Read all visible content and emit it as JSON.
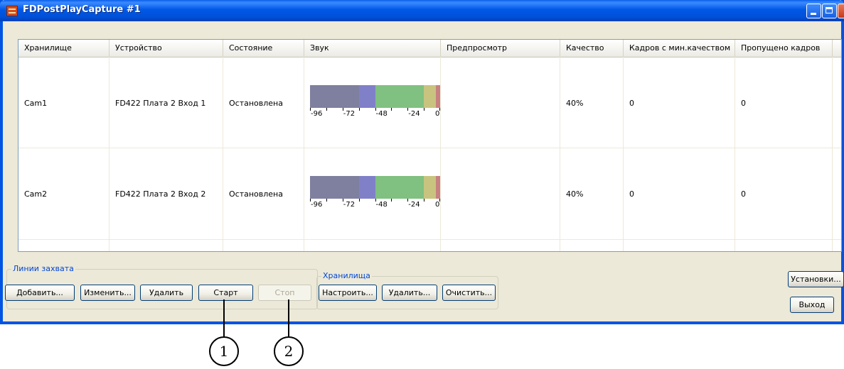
{
  "window": {
    "title": "FDPostPlayCapture #1"
  },
  "table": {
    "columns": [
      "Хранилище",
      "Устройство",
      "Состояние",
      "Звук",
      "Предпросмотр",
      "Качество",
      "Кадров с мин.качеством",
      "Пропущено кадров"
    ],
    "rows": [
      {
        "storage": "Cam1",
        "device": "FD422 Плата 2 Вход 1",
        "state": "Остановлена",
        "preview": "",
        "quality": "40%",
        "min_quality_frames": "0",
        "dropped_frames": "0"
      },
      {
        "storage": "Cam2",
        "device": "FD422 Плата 2 Вход 2",
        "state": "Остановлена",
        "preview": "",
        "quality": "40%",
        "min_quality_frames": "0",
        "dropped_frames": "0"
      }
    ]
  },
  "audio_meter": {
    "scale_labels": [
      "-96",
      "-72",
      "-48",
      "-24",
      "0"
    ],
    "segments": [
      {
        "from_db": -96,
        "to_db": -60,
        "color": "#7f7f9f"
      },
      {
        "from_db": -60,
        "to_db": -48,
        "color": "#8080c8"
      },
      {
        "from_db": -48,
        "to_db": -12,
        "color": "#80c080"
      },
      {
        "from_db": -12,
        "to_db": -3,
        "color": "#c8c480"
      },
      {
        "from_db": -3,
        "to_db": 0,
        "color": "#c88080"
      }
    ]
  },
  "capture_group": {
    "label": "Линии захвата",
    "add": "Добавить...",
    "edit": "Изменить...",
    "remove": "Удалить",
    "start": "Старт",
    "stop": "Стоп"
  },
  "storage_group": {
    "label": "Хранилища",
    "configure": "Настроить...",
    "remove": "Удалить...",
    "clear": "Очистить..."
  },
  "side_buttons": {
    "settings": "Установки...",
    "exit": "Выход"
  },
  "callouts": [
    "1",
    "2"
  ]
}
